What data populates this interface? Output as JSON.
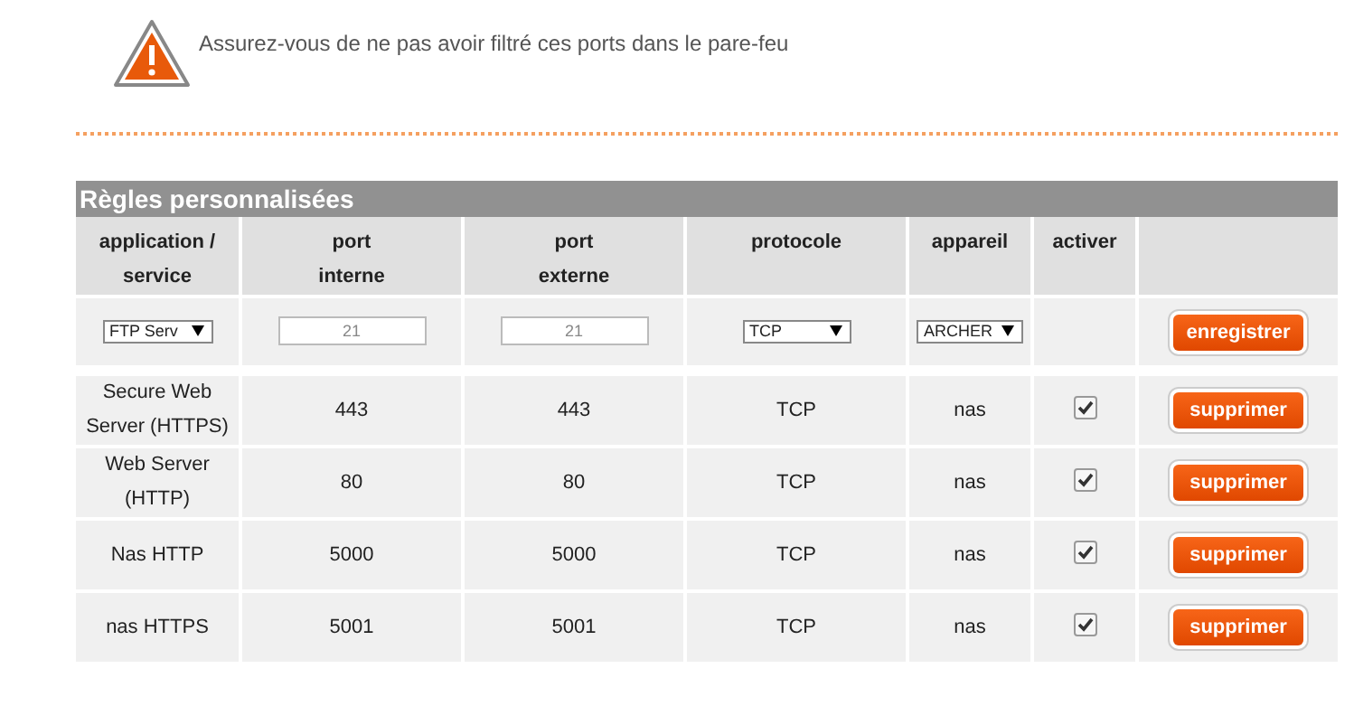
{
  "warning": {
    "text": "Assurez-vous de ne pas avoir filtré ces ports dans le pare-feu"
  },
  "table": {
    "title": "Règles personnalisées",
    "columns": [
      {
        "lines": [
          "application /",
          "service"
        ]
      },
      {
        "lines": [
          "port",
          "interne"
        ]
      },
      {
        "lines": [
          "port",
          "externe"
        ]
      },
      {
        "lines": [
          "protocole"
        ]
      },
      {
        "lines": [
          "appareil"
        ]
      },
      {
        "lines": [
          "activer"
        ]
      },
      {}
    ],
    "new_rule": {
      "application": "FTP Serv",
      "internal_port": {
        "placeholder": "21"
      },
      "external_port": {
        "placeholder": "21"
      },
      "protocol": "TCP",
      "device": "ARCHER",
      "button": "enregistrer"
    },
    "rows": [
      {
        "application": "Secure Web Server (HTTPS)",
        "internal_port": "443",
        "external_port": "443",
        "protocol": "TCP",
        "device": "nas",
        "checked": true,
        "button": "supprimer"
      },
      {
        "application": "Web Server (HTTP)",
        "internal_port": "80",
        "external_port": "80",
        "protocol": "TCP",
        "device": "nas",
        "checked": true,
        "button": "supprimer"
      },
      {
        "application": "Nas HTTP",
        "internal_port": "5000",
        "external_port": "5000",
        "protocol": "TCP",
        "device": "nas",
        "checked": true,
        "button": "supprimer"
      },
      {
        "application": "nas HTTPS",
        "internal_port": "5001",
        "external_port": "5001",
        "protocol": "TCP",
        "device": "nas",
        "checked": true,
        "button": "supprimer"
      }
    ]
  }
}
